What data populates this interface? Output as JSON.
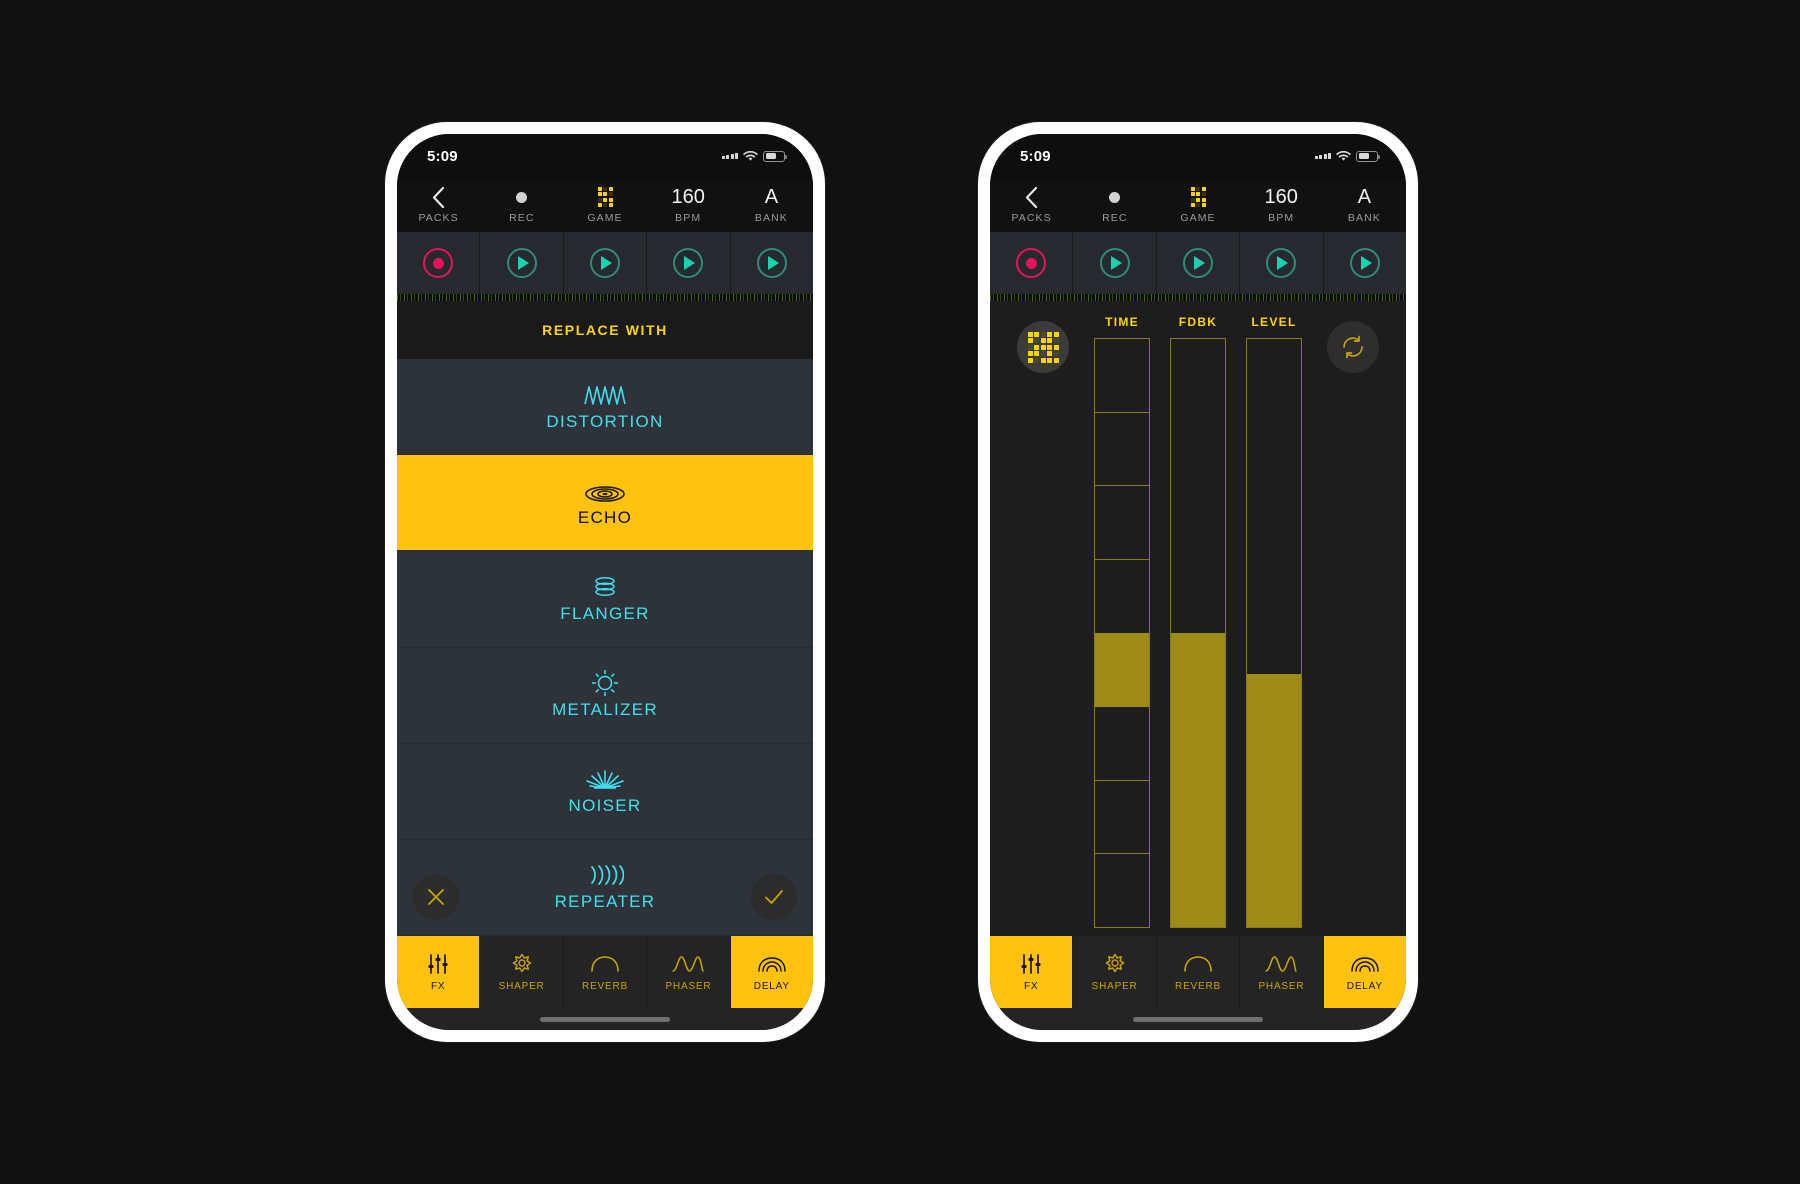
{
  "meta": {
    "background_color": "#111111",
    "accent_yellow": "#ffc20e",
    "accent_cyan": "#3fe0f0",
    "accent_teal": "#19d3b0",
    "accent_pink": "#e8115b"
  },
  "phone1": {
    "status": {
      "time": "5:09",
      "battery_icon": "battery-icon",
      "wifi_icon": "wifi-icon",
      "signal_icon": "signal-dots-icon"
    },
    "topnav": [
      {
        "glyph": "chevron-left-icon",
        "value": "‹",
        "label": "PACKS"
      },
      {
        "glyph": "record-dot-icon",
        "value": "",
        "label": "REC"
      },
      {
        "glyph": "game-grid-icon",
        "value": "",
        "label": "GAME"
      },
      {
        "glyph": "bpm-value",
        "value": "160",
        "label": "BPM"
      },
      {
        "glyph": "bank-letter",
        "value": "A",
        "label": "BANK"
      }
    ],
    "transport": [
      {
        "type": "record",
        "name": "record-button"
      },
      {
        "type": "play",
        "name": "play-button-1"
      },
      {
        "type": "play",
        "name": "play-button-2"
      },
      {
        "type": "play",
        "name": "play-button-3"
      },
      {
        "type": "play",
        "name": "play-button-4"
      }
    ],
    "list_header": "REPLACE WITH",
    "fx_list": [
      {
        "name": "DISTORTION",
        "icon": "distortion-zigzag-icon",
        "selected": false
      },
      {
        "name": "ECHO",
        "icon": "echo-rings-icon",
        "selected": true
      },
      {
        "name": "FLANGER",
        "icon": "flanger-disc-icon",
        "selected": false
      },
      {
        "name": "METALIZER",
        "icon": "metalizer-starburst-icon",
        "selected": false
      },
      {
        "name": "NOISER",
        "icon": "noiser-burst-icon",
        "selected": false
      },
      {
        "name": "REPEATER",
        "icon": "repeater-arcs-icon",
        "selected": false
      }
    ],
    "cancel_button": "cancel-x-icon",
    "confirm_button": "confirm-check-icon",
    "tabs": [
      {
        "label": "FX",
        "icon": "sliders-icon",
        "active": true
      },
      {
        "label": "SHAPER",
        "icon": "shaper-star-icon",
        "active": false
      },
      {
        "label": "REVERB",
        "icon": "reverb-arc-icon",
        "active": false
      },
      {
        "label": "PHASER",
        "icon": "phaser-wave-icon",
        "active": false
      },
      {
        "label": "DELAY",
        "icon": "delay-waves-icon",
        "active": true
      }
    ]
  },
  "phone2": {
    "status": {
      "time": "5:09",
      "battery_icon": "battery-icon",
      "wifi_icon": "wifi-icon",
      "signal_icon": "signal-dots-icon"
    },
    "topnav": [
      {
        "glyph": "chevron-left-icon",
        "value": "‹",
        "label": "PACKS"
      },
      {
        "glyph": "record-dot-icon",
        "value": "",
        "label": "REC"
      },
      {
        "glyph": "game-grid-icon",
        "value": "",
        "label": "GAME"
      },
      {
        "glyph": "bpm-value",
        "value": "160",
        "label": "BPM"
      },
      {
        "glyph": "bank-letter",
        "value": "A",
        "label": "BANK"
      }
    ],
    "transport": [
      {
        "type": "record",
        "name": "record-button"
      },
      {
        "type": "play",
        "name": "play-button-1"
      },
      {
        "type": "play",
        "name": "play-button-2"
      },
      {
        "type": "play",
        "name": "play-button-3"
      },
      {
        "type": "play",
        "name": "play-button-4"
      }
    ],
    "preset_button": "pattern-grid-icon",
    "reset_button": "loop-refresh-icon",
    "sliders": [
      {
        "label": "TIME",
        "value_pct": 50,
        "segmented": true,
        "segments": 8
      },
      {
        "label": "FDBK",
        "value_pct": 50,
        "segmented": false
      },
      {
        "label": "LEVEL",
        "value_pct": 43,
        "segmented": false
      }
    ],
    "tabs": [
      {
        "label": "FX",
        "icon": "sliders-icon",
        "active": true
      },
      {
        "label": "SHAPER",
        "icon": "shaper-star-icon",
        "active": false
      },
      {
        "label": "REVERB",
        "icon": "reverb-arc-icon",
        "active": false
      },
      {
        "label": "PHASER",
        "icon": "phaser-wave-icon",
        "active": false
      },
      {
        "label": "DELAY",
        "icon": "delay-waves-icon",
        "active": true
      }
    ]
  }
}
